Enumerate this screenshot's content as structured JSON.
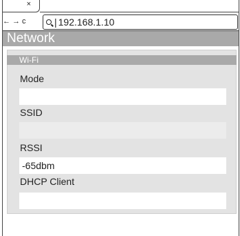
{
  "browser": {
    "tab_close": "×",
    "nav": {
      "back": "←",
      "forward": "→",
      "reload": "c"
    },
    "url": "192.168.1.10"
  },
  "page": {
    "title": "Network",
    "section": "Wi-Fi",
    "fields": {
      "mode": {
        "label": "Mode",
        "value": ""
      },
      "ssid": {
        "label": "SSID",
        "value": ""
      },
      "rssi": {
        "label": "RSSI",
        "value": "-65dbm"
      },
      "dhcp": {
        "label": "DHCP Client",
        "value": ""
      }
    }
  },
  "colors": {
    "header_bg": "#a9a9a9",
    "panel_bg": "#e3e3e3",
    "field_bg": "#ffffff",
    "field_disabled_bg": "#ececec"
  }
}
